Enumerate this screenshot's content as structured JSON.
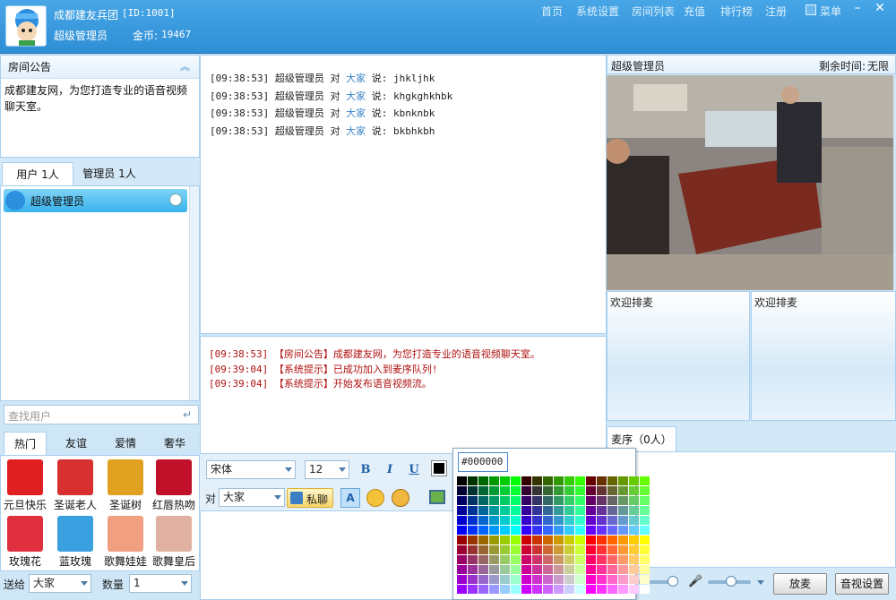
{
  "header": {
    "room_name": "成都建友兵团",
    "room_id": "[ID:1001]",
    "role": "超级管理员",
    "coins_label": "金币:",
    "coins": "19467",
    "nav": [
      "首页",
      "系统设置",
      "房间列表",
      "充值",
      "排行榜",
      "注册"
    ],
    "menu": "菜单"
  },
  "announcement": {
    "title": "房间公告",
    "text": "成都建友网，为您打造专业的语音视频聊天室。"
  },
  "user_tabs": {
    "users": "用户 1人",
    "admins": "管理员 1人"
  },
  "users": [
    {
      "name": "超级管理员"
    }
  ],
  "search": {
    "placeholder": "查找用户"
  },
  "gift_tabs": [
    "热门",
    "友谊",
    "爱情",
    "奢华"
  ],
  "gifts": [
    {
      "name": "元旦快乐",
      "color": "#e02020",
      "icon": "new-year-gift"
    },
    {
      "name": "圣诞老人",
      "color": "#d83030",
      "icon": "santa-gift"
    },
    {
      "name": "圣诞树",
      "color": "#e0a020",
      "icon": "christmas-tree-gift"
    },
    {
      "name": "红唇热吻",
      "color": "#c0102a",
      "icon": "red-lips-gift"
    },
    {
      "name": "玫瑰花",
      "color": "#e03040",
      "icon": "rose-gift"
    },
    {
      "name": "蓝玫瑰",
      "color": "#3aa0e0",
      "icon": "blue-rose-gift"
    },
    {
      "name": "歌舞娃娃",
      "color": "#f0a080",
      "icon": "dance-doll-gift"
    },
    {
      "name": "歌舞皇后",
      "color": "#e0b0a0",
      "icon": "dance-queen-gift"
    }
  ],
  "send": {
    "label": "送给",
    "target": "大家",
    "qty_label": "数量",
    "qty": "1"
  },
  "messages": [
    {
      "time": "[09:38:53]",
      "from": "超级管理员",
      "to_word": "对",
      "to": "大家",
      "say": "说:",
      "text": "jhkljhk"
    },
    {
      "time": "[09:38:53]",
      "from": "超级管理员",
      "to_word": "对",
      "to": "大家",
      "say": "说:",
      "text": "khgkghkhbk"
    },
    {
      "time": "[09:38:53]",
      "from": "超级管理员",
      "to_word": "对",
      "to": "大家",
      "say": "说:",
      "text": "kbnknbk"
    },
    {
      "time": "[09:38:53]",
      "from": "超级管理员",
      "to_word": "对",
      "to": "大家",
      "say": "说:",
      "text": "bkbhkbh"
    }
  ],
  "system_messages": [
    {
      "time": "[09:38:53]",
      "tag": "【房间公告】",
      "text": "成都建友网，为您打造专业的语音视频聊天室。"
    },
    {
      "time": "[09:39:04]",
      "tag": "【系统提示】",
      "text": "已成功加入到麦序队列!"
    },
    {
      "time": "[09:39:04]",
      "tag": "【系统提示】",
      "text": "开始发布语音视频流。"
    }
  ],
  "toolbar": {
    "font": "宋体",
    "size": "12",
    "bold": "B",
    "italic": "I",
    "underline": "U",
    "to_label": "对",
    "to": "大家",
    "private": "私聊"
  },
  "color_picker": {
    "value": "#000000"
  },
  "video": {
    "user": "超级管理员",
    "remaining_label": "剩余时间:",
    "remaining": "无限"
  },
  "queue_slots": [
    "欢迎排麦",
    "欢迎排麦"
  ],
  "mic_queue": {
    "title": "麦序（0人）"
  },
  "buttons": {
    "release_mic": "放麦",
    "av_settings": "音视设置"
  }
}
